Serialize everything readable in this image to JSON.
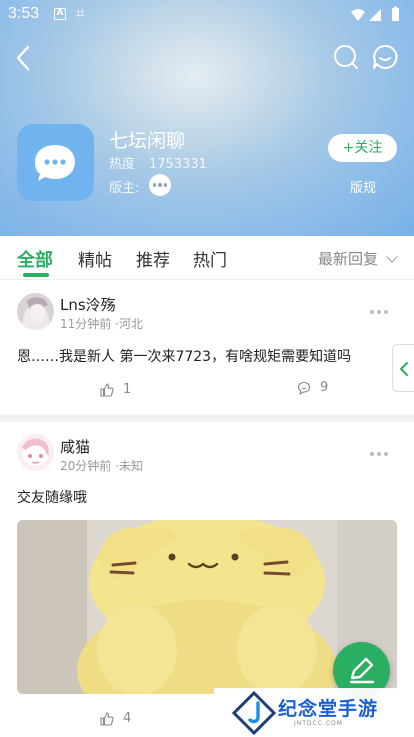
{
  "status_bar": {
    "time": "3:53",
    "icon_a": "A"
  },
  "header": {
    "board_name": "七坛闲聊",
    "heat_label": "热度",
    "heat_value": "1753331",
    "moderator_label": "版主:",
    "follow_label": "+关注",
    "rules_label": "版规"
  },
  "tabs": {
    "items": [
      "全部",
      "精帖",
      "推荐",
      "热门"
    ],
    "active": "全部",
    "sort_label": "最新回复"
  },
  "posts": [
    {
      "username": "Lns泠殇",
      "meta": "11分钟前 ·河北",
      "text": "恩……我是新人 第一次来7723，有啥规矩需要知道吗",
      "likes": "1",
      "comments": "9"
    },
    {
      "username": "咸猫",
      "meta": "20分钟前 ·未知",
      "text": "交友随缘哦",
      "likes": "4"
    }
  ],
  "watermark": {
    "text": "纪念堂手游",
    "sub": "JNTDCC.COM"
  },
  "colors": {
    "accent": "#2aae62",
    "banner": "#8fbde9"
  }
}
